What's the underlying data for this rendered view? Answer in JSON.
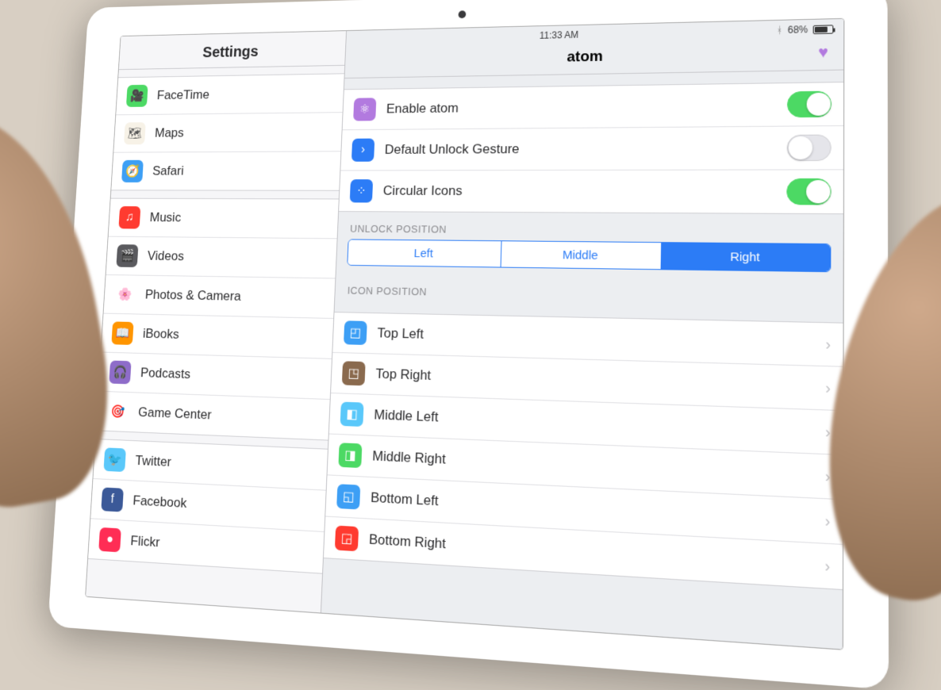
{
  "status": {
    "time": "11:33 AM",
    "battery_pct": "68%"
  },
  "sidebar": {
    "title": "Settings",
    "groups": [
      {
        "items": [
          {
            "label": "FaceTime",
            "icon": "facetime-icon",
            "bg": "#4cd964"
          },
          {
            "label": "Maps",
            "icon": "maps-icon",
            "bg": "#f7f2e7"
          },
          {
            "label": "Safari",
            "icon": "safari-icon",
            "bg": "#3d9ff5"
          }
        ]
      },
      {
        "items": [
          {
            "label": "Music",
            "icon": "music-icon",
            "bg": "#ff3b30"
          },
          {
            "label": "Videos",
            "icon": "videos-icon",
            "bg": "#5a5a5e"
          },
          {
            "label": "Photos & Camera",
            "icon": "photos-icon",
            "bg": "#ffffff"
          },
          {
            "label": "iBooks",
            "icon": "ibooks-icon",
            "bg": "#ff9500"
          },
          {
            "label": "Podcasts",
            "icon": "podcasts-icon",
            "bg": "#8e6cc9"
          },
          {
            "label": "Game Center",
            "icon": "gamecenter-icon",
            "bg": "#ffffff"
          }
        ]
      },
      {
        "items": [
          {
            "label": "Twitter",
            "icon": "twitter-icon",
            "bg": "#5ac8fa"
          },
          {
            "label": "Facebook",
            "icon": "facebook-icon",
            "bg": "#3b5998"
          },
          {
            "label": "Flickr",
            "icon": "flickr-icon",
            "bg": "#ff2d55"
          }
        ]
      }
    ]
  },
  "detail": {
    "title": "atom",
    "toggles": [
      {
        "label": "Enable atom",
        "icon": "atom-icon",
        "bg": "#b27adf",
        "on": true
      },
      {
        "label": "Default Unlock Gesture",
        "icon": "gesture-icon",
        "bg": "#2c7cf6",
        "on": false
      },
      {
        "label": "Circular Icons",
        "icon": "dots-icon",
        "bg": "#2c7cf6",
        "on": true
      }
    ],
    "unlock_position": {
      "title": "UNLOCK POSITION",
      "options": [
        "Left",
        "Middle",
        "Right"
      ],
      "selected": 2
    },
    "icon_position": {
      "title": "ICON POSITION",
      "items": [
        {
          "label": "Top Left",
          "icon": "topleft-icon",
          "bg": "#3d9ff5"
        },
        {
          "label": "Top Right",
          "icon": "topright-icon",
          "bg": "#8a6a4e"
        },
        {
          "label": "Middle Left",
          "icon": "middleleft-icon",
          "bg": "#5ac8fa"
        },
        {
          "label": "Middle Right",
          "icon": "middleright-icon",
          "bg": "#4cd964"
        },
        {
          "label": "Bottom Left",
          "icon": "bottomleft-icon",
          "bg": "#3d9ff5"
        },
        {
          "label": "Bottom Right",
          "icon": "bottomright-icon",
          "bg": "#ff3b30"
        }
      ]
    }
  }
}
